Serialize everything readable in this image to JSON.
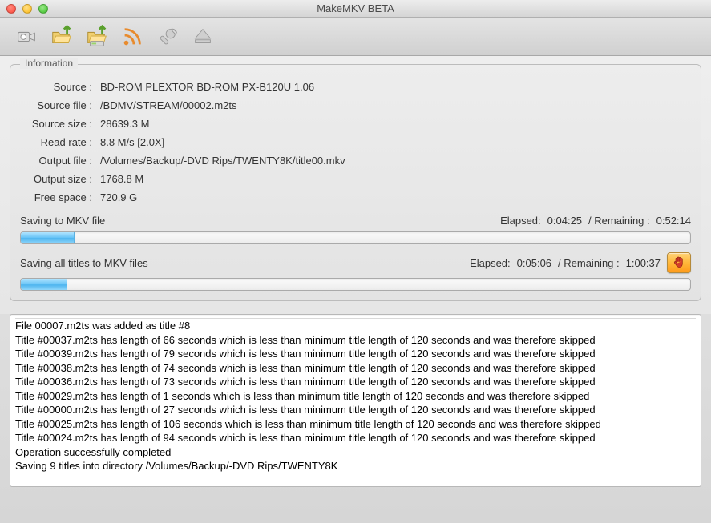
{
  "window": {
    "title": "MakeMKV BETA"
  },
  "toolbar": {
    "icons": [
      "camera-icon",
      "open-folder-icon",
      "open-disc-icon",
      "stream-icon",
      "wrench-icon",
      "eject-icon"
    ]
  },
  "info": {
    "legend": "Information",
    "rows": [
      {
        "label": "Source :",
        "value": "BD-ROM PLEXTOR BD-ROM PX-B120U 1.06"
      },
      {
        "label": "Source file :",
        "value": "/BDMV/STREAM/00002.m2ts"
      },
      {
        "label": "Source size :",
        "value": "28639.3 M"
      },
      {
        "label": "Read rate :",
        "value": "8.8 M/s [2.0X]"
      },
      {
        "label": "Output file :",
        "value": "/Volumes/Backup/-DVD Rips/TWENTY8K/title00.mkv"
      },
      {
        "label": "Output size :",
        "value": "1768.8 M"
      },
      {
        "label": "Free space :",
        "value": "720.9 G"
      }
    ]
  },
  "progress1": {
    "title": "Saving to MKV file",
    "elapsed_label": "Elapsed:",
    "elapsed": "0:04:25",
    "remaining_label": "/ Remaining :",
    "remaining": "0:52:14",
    "percent": 8
  },
  "progress2": {
    "title": "Saving all titles to MKV files",
    "elapsed_label": "Elapsed:",
    "elapsed": "0:05:06",
    "remaining_label": "/ Remaining :",
    "remaining": "1:00:37",
    "percent": 7
  },
  "log": {
    "lines": [
      "File 00007.m2ts was added as title #8",
      "Title #00037.m2ts has length of 66 seconds which is less than minimum title length of 120 seconds and was therefore skipped",
      "Title #00039.m2ts has length of 79 seconds which is less than minimum title length of 120 seconds and was therefore skipped",
      "Title #00038.m2ts has length of 74 seconds which is less than minimum title length of 120 seconds and was therefore skipped",
      "Title #00036.m2ts has length of 73 seconds which is less than minimum title length of 120 seconds and was therefore skipped",
      "Title #00029.m2ts has length of 1 seconds which is less than minimum title length of 120 seconds and was therefore skipped",
      "Title #00000.m2ts has length of 27 seconds which is less than minimum title length of 120 seconds and was therefore skipped",
      "Title #00025.m2ts has length of 106 seconds which is less than minimum title length of 120 seconds and was therefore skipped",
      "Title #00024.m2ts has length of 94 seconds which is less than minimum title length of 120 seconds and was therefore skipped",
      "Operation successfully completed",
      "Saving 9 titles into directory /Volumes/Backup/-DVD Rips/TWENTY8K"
    ]
  }
}
